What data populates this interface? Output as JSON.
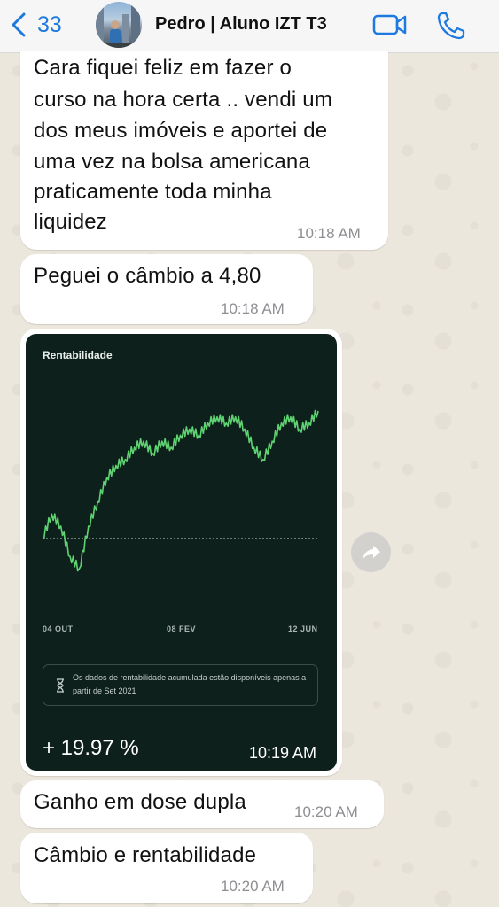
{
  "header": {
    "back_count": "33",
    "title": "Pedro | Aluno IZT T3"
  },
  "messages": [
    {
      "text": "Cara fiquei feliz em fazer o curso na hora certa .. vendi um dos meus imóveis e aportei de uma vez na bolsa americana praticamente toda minha liquidez",
      "time": "10:18 AM",
      "lines": [
        "Cara fiquei feliz em fazer o",
        "curso na hora certa .. vendi um",
        "dos meus imóveis e aportei de",
        "uma vez na bolsa americana",
        "praticamente toda minha",
        "liquidez"
      ]
    },
    {
      "text": "Peguei o câmbio a 4,80",
      "time": "10:18 AM"
    },
    {
      "text": "Ganho em dose dupla",
      "time": "10:20 AM"
    },
    {
      "text": "Câmbio e rentabilidade",
      "time": "10:20 AM"
    }
  ],
  "image_message": {
    "time": "10:19 AM",
    "return_label": "+ 19.97 %",
    "info_text": "Os dados de rentabilidade acumulada estão disponíveis apenas a partir de Set 2021"
  },
  "chart_data": {
    "type": "line",
    "title": "Rentabilidade",
    "x_tick_labels": [
      "04 OUT",
      "08 FEV",
      "12 JUN"
    ],
    "baseline": 0,
    "y_range": [
      -5,
      22
    ],
    "series": [
      {
        "values": [
          0,
          4,
          2,
          -3,
          -5,
          2,
          6,
          10,
          12,
          13,
          15,
          16,
          14,
          16,
          15,
          17,
          18,
          17,
          19,
          20,
          19,
          20,
          18,
          15,
          13,
          16,
          19,
          20,
          18,
          19,
          21
        ],
        "color": "#5fd372"
      }
    ],
    "colors": {
      "background": "#0e201b",
      "line": "#5fd372",
      "baseline": "#8a9994"
    }
  },
  "icons": {
    "back": "chevron-left-icon",
    "video": "video-camera-icon",
    "call": "phone-icon",
    "forward": "forward-arrow-icon",
    "hourglass": "hourglass-icon"
  }
}
